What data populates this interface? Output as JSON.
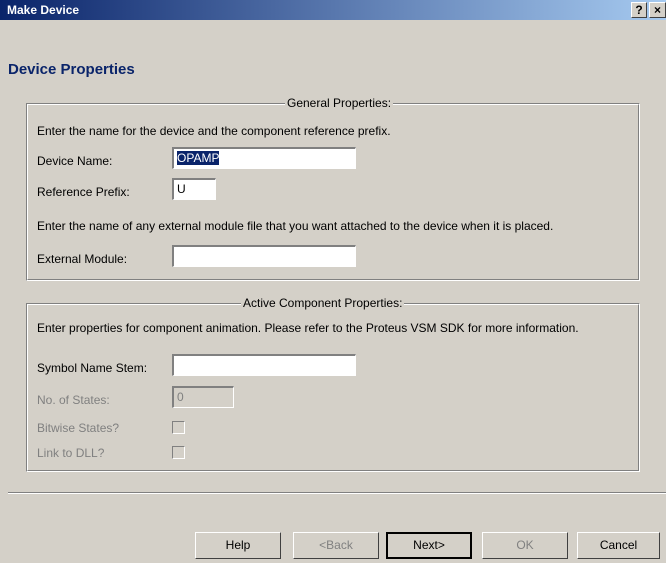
{
  "window": {
    "title": "Make Device",
    "help_glyph": "?",
    "close_glyph": "×"
  },
  "heading": "Device Properties",
  "general": {
    "legend": "General Properties:",
    "intro": "Enter the name for the device and the component reference prefix.",
    "device_name_label": "Device Name:",
    "device_name_value": "OPAMP",
    "ref_prefix_label": "Reference Prefix:",
    "ref_prefix_value": "U",
    "module_intro": "Enter the name of any external module file that you want attached to the device when it is placed.",
    "external_module_label": "External Module:",
    "external_module_value": ""
  },
  "active": {
    "legend": "Active Component Properties:",
    "intro": "Enter properties for component animation. Please refer to the Proteus VSM SDK for more information.",
    "symbol_stem_label": "Symbol Name Stem:",
    "symbol_stem_value": "",
    "states_label": "No. of States:",
    "states_value": "0",
    "bitwise_label": "Bitwise States?",
    "link_dll_label": "Link to DLL?"
  },
  "buttons": {
    "help": "Help",
    "back": "<Back",
    "next": "Next>",
    "ok": "OK",
    "cancel": "Cancel"
  }
}
